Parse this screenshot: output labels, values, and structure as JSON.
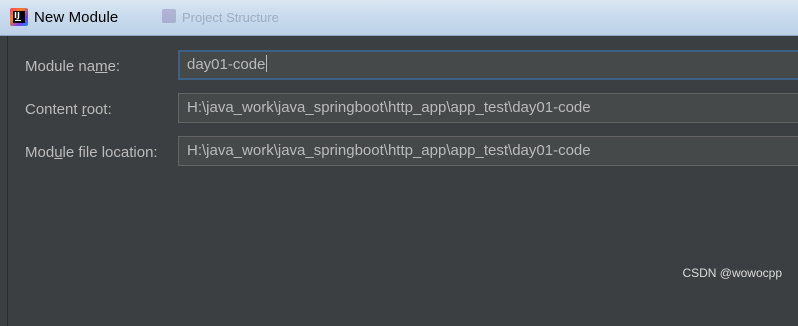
{
  "window": {
    "title": "New Module",
    "background_window_title": "Project Structure"
  },
  "form": {
    "module_name": {
      "label_pre": "Module na",
      "label_mnemonic": "m",
      "label_post": "e:",
      "value": "day01-code"
    },
    "content_root": {
      "label_pre": "Content ",
      "label_mnemonic": "r",
      "label_post": "oot:",
      "value": "H:\\java_work\\java_springboot\\http_app\\app_test\\day01-code"
    },
    "module_file_location": {
      "label_pre": "Mod",
      "label_mnemonic": "u",
      "label_post": "le file location:",
      "value": "H:\\java_work\\java_springboot\\http_app\\app_test\\day01-code"
    }
  },
  "watermark": "CSDN @wowocpp",
  "colors": {
    "dialog_bg": "#3c3f41",
    "input_bg": "#45494a",
    "focus_border": "#3d6185",
    "text": "#bbbbbb"
  }
}
